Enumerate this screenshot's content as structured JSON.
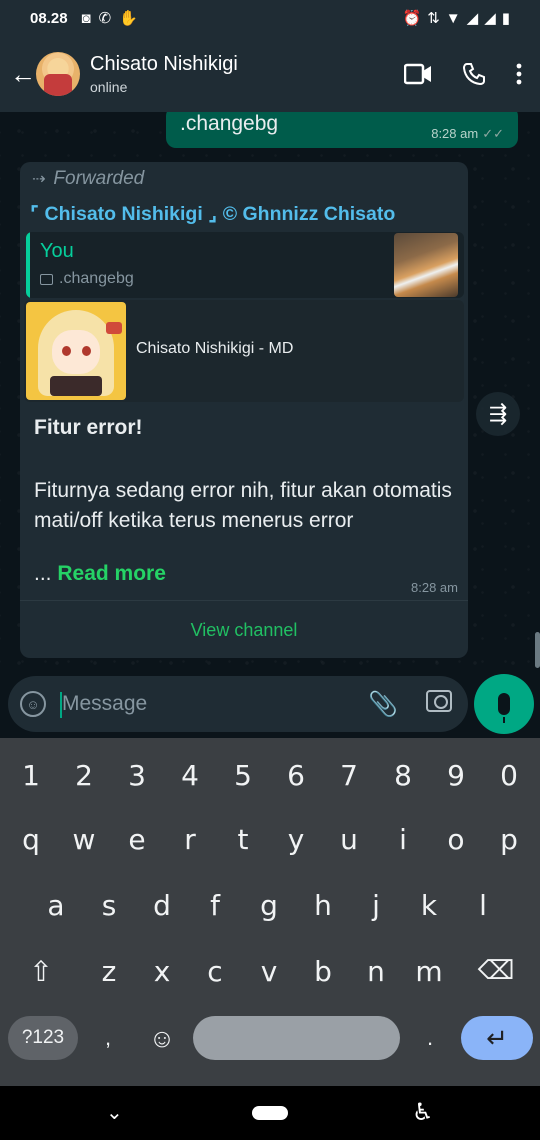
{
  "status_bar": {
    "time": "08.28",
    "icons_left": [
      "instagram-icon",
      "whatsapp-icon",
      "hand-icon"
    ],
    "icons_right": [
      "alarm-icon",
      "data-arrows-icon",
      "wifi-icon",
      "signal-icon",
      "signal-icon",
      "battery-icon"
    ]
  },
  "header": {
    "contact_name": "Chisato Nishikigi",
    "status": "online"
  },
  "chat": {
    "outgoing": {
      "text": ".changebg",
      "time": "8:28 am"
    },
    "incoming": {
      "forwarded_label": "Forwarded",
      "channel_title": "⌜ Chisato Nishikigi ⌟ © Ghnnizz Chisato",
      "quote_author": "You",
      "quote_text": ".changebg",
      "preview_title": "Chisato Nishikigi - MD",
      "heading": "Fitur error!",
      "body": "Fiturnya sedang error nih, fitur akan otomatis mati/off ketika terus menerus error",
      "ellipsis": "...",
      "read_more": "Read more",
      "time": "8:28 am",
      "view_channel": "View channel"
    }
  },
  "composer": {
    "placeholder": "Message"
  },
  "keyboard": {
    "row_numbers": [
      "1",
      "2",
      "3",
      "4",
      "5",
      "6",
      "7",
      "8",
      "9",
      "0"
    ],
    "row_1": [
      "q",
      "w",
      "e",
      "r",
      "t",
      "y",
      "u",
      "i",
      "o",
      "p"
    ],
    "row_2": [
      "a",
      "s",
      "d",
      "f",
      "g",
      "h",
      "j",
      "k",
      "l"
    ],
    "row_3": [
      "z",
      "x",
      "c",
      "v",
      "b",
      "n",
      "m"
    ],
    "symbols_key": "?123",
    "comma_key": ",",
    "period_key": "."
  },
  "colors": {
    "header_bg": "#1f2c34",
    "chat_bg": "#0b141a",
    "outgoing_bubble": "#005c4b",
    "incoming_bubble": "#1f2c34",
    "accent_green": "#25d366",
    "link_blue": "#53bdeb",
    "keyboard_bg": "#3b3f43",
    "enter_key": "#8ab4f8"
  }
}
